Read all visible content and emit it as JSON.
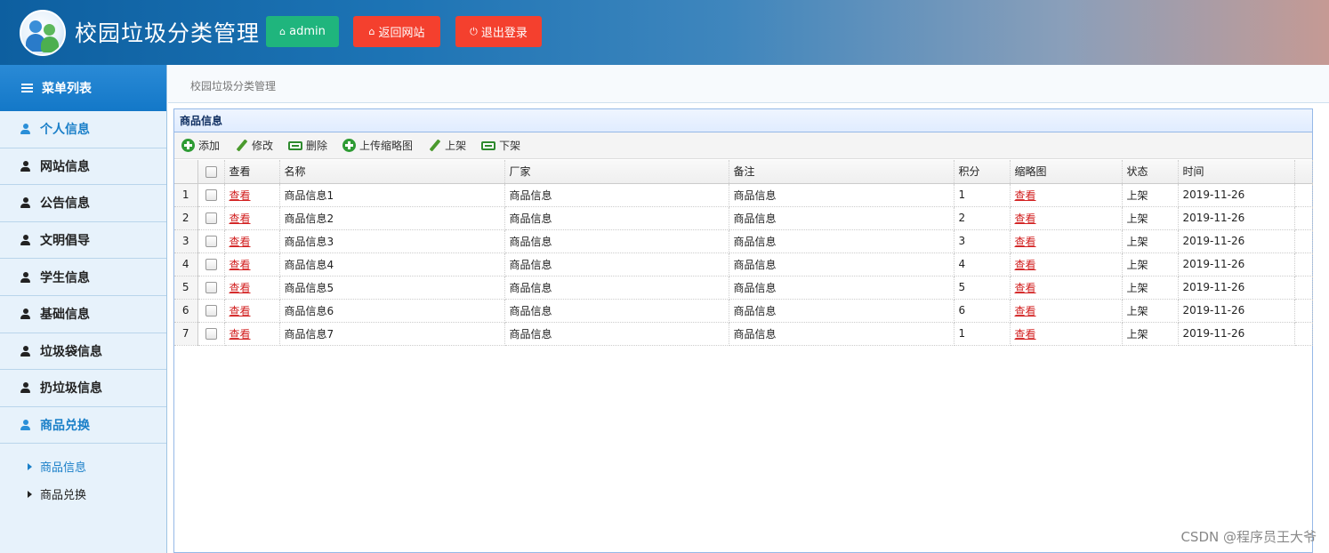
{
  "header": {
    "site_title": "校园垃圾分类管理",
    "admin_label": "admin",
    "home_label": "返回网站",
    "logout_label": "退出登录"
  },
  "sidebar": {
    "menu_title": "菜单列表",
    "items": [
      {
        "label": "个人信息"
      },
      {
        "label": "网站信息"
      },
      {
        "label": "公告信息"
      },
      {
        "label": "文明倡导"
      },
      {
        "label": "学生信息"
      },
      {
        "label": "基础信息"
      },
      {
        "label": "垃圾袋信息"
      },
      {
        "label": "扔垃圾信息"
      },
      {
        "label": "商品兑换"
      }
    ],
    "submenu": [
      {
        "label": "商品信息"
      },
      {
        "label": "商品兑换"
      }
    ]
  },
  "breadcrumb": "校园垃圾分类管理",
  "panel": {
    "title": "商品信息",
    "toolbar": {
      "add": "添加",
      "edit": "修改",
      "delete": "删除",
      "upload_thumb": "上传缩略图",
      "on_shelf": "上架",
      "off_shelf": "下架"
    },
    "columns": [
      "查看",
      "名称",
      "厂家",
      "备注",
      "积分",
      "缩略图",
      "状态",
      "时间"
    ],
    "rows": [
      {
        "n": "1",
        "view": "查看",
        "name": "商品信息1",
        "maker": "商品信息",
        "note": "商品信息",
        "points": "1",
        "thumb": "查看",
        "status": "上架",
        "time": "2019-11-26"
      },
      {
        "n": "2",
        "view": "查看",
        "name": "商品信息2",
        "maker": "商品信息",
        "note": "商品信息",
        "points": "2",
        "thumb": "查看",
        "status": "上架",
        "time": "2019-11-26"
      },
      {
        "n": "3",
        "view": "查看",
        "name": "商品信息3",
        "maker": "商品信息",
        "note": "商品信息",
        "points": "3",
        "thumb": "查看",
        "status": "上架",
        "time": "2019-11-26"
      },
      {
        "n": "4",
        "view": "查看",
        "name": "商品信息4",
        "maker": "商品信息",
        "note": "商品信息",
        "points": "4",
        "thumb": "查看",
        "status": "上架",
        "time": "2019-11-26"
      },
      {
        "n": "5",
        "view": "查看",
        "name": "商品信息5",
        "maker": "商品信息",
        "note": "商品信息",
        "points": "5",
        "thumb": "查看",
        "status": "上架",
        "time": "2019-11-26"
      },
      {
        "n": "6",
        "view": "查看",
        "name": "商品信息6",
        "maker": "商品信息",
        "note": "商品信息",
        "points": "6",
        "thumb": "查看",
        "status": "上架",
        "time": "2019-11-26"
      },
      {
        "n": "7",
        "view": "查看",
        "name": "商品信息7",
        "maker": "商品信息",
        "note": "商品信息",
        "points": "1",
        "thumb": "查看",
        "status": "上架",
        "time": "2019-11-26"
      }
    ]
  },
  "watermark": "CSDN @程序员王大爷",
  "colors": {
    "header_blue": "#1d74b5",
    "admin_green": "#1fb57d",
    "action_red": "#f4402e",
    "link_red": "#d21f1f",
    "active_blue": "#1a7fc8"
  }
}
